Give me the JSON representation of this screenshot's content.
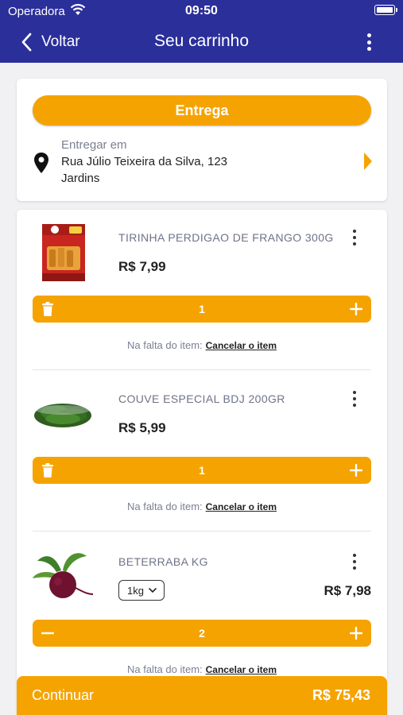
{
  "status_bar": {
    "carrier": "Operadora",
    "time": "09:50"
  },
  "nav": {
    "back_label": "Voltar",
    "title": "Seu carrinho"
  },
  "delivery": {
    "mode_label": "Entrega",
    "label": "Entregar em",
    "address_line1": "Rua Júlio Teixeira da Silva, 123",
    "address_line2": "Jardins"
  },
  "items": [
    {
      "name": "TIRINHA PERDIGAO DE FRANGO 300G",
      "price": "R$ 7,99",
      "quantity": "1",
      "missing_text": "Na falta do item:",
      "missing_action": "Cancelar o item"
    },
    {
      "name": "COUVE ESPECIAL BDJ 200GR",
      "price": "R$ 5,99",
      "quantity": "1",
      "missing_text": "Na falta do item:",
      "missing_action": "Cancelar o item"
    },
    {
      "name": "BETERRABA KG",
      "unit": "1kg",
      "price": "R$ 7,98",
      "quantity": "2",
      "missing_text": "Na falta do item:",
      "missing_action": "Cancelar o item"
    }
  ],
  "footer": {
    "continue_label": "Continuar",
    "total": "R$ 75,43"
  },
  "colors": {
    "header": "#2b2f9a",
    "accent": "#f5a300"
  },
  "icons": [
    "wifi-icon",
    "battery-icon",
    "chevron-left-icon",
    "more-vertical-icon",
    "location-pin-icon",
    "chevron-right-icon",
    "trash-icon",
    "plus-icon",
    "minus-icon",
    "chevron-down-icon"
  ]
}
